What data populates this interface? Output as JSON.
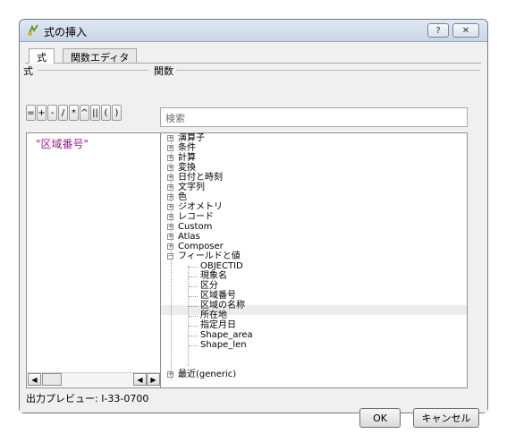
{
  "window": {
    "title": "式の挿入",
    "help_label": "?",
    "close_label": "✕"
  },
  "tabs": [
    {
      "label": "式",
      "active": true
    },
    {
      "label": "関数エディタ",
      "active": false
    }
  ],
  "expression_group": {
    "label": "式",
    "operators": [
      "=",
      "+",
      "-",
      "/",
      "*",
      "^",
      "||",
      "(",
      ")"
    ],
    "expression_text": "\"区域番号\"",
    "preview_label": "出力プレビュー:",
    "preview_value": "I-33-0700"
  },
  "functions_group": {
    "label": "関数",
    "search_placeholder": "検索",
    "tree": [
      {
        "label": "演算子",
        "expandable": true
      },
      {
        "label": "条件",
        "expandable": true
      },
      {
        "label": "計算",
        "expandable": true
      },
      {
        "label": "変換",
        "expandable": true
      },
      {
        "label": "日付と時刻",
        "expandable": true
      },
      {
        "label": "文字列",
        "expandable": true
      },
      {
        "label": "色",
        "expandable": true
      },
      {
        "label": "ジオメトリ",
        "expandable": true
      },
      {
        "label": "レコード",
        "expandable": true
      },
      {
        "label": "Custom",
        "expandable": true
      },
      {
        "label": "Atlas",
        "expandable": true
      },
      {
        "label": "Composer",
        "expandable": true
      },
      {
        "label": "フィールドと値",
        "expandable": true,
        "expanded": true
      },
      {
        "label": "OBJECTID",
        "child": true
      },
      {
        "label": "現象名",
        "child": true
      },
      {
        "label": "区分",
        "child": true
      },
      {
        "label": "区域番号",
        "child": true,
        "selected": true
      },
      {
        "label": "区域の名称",
        "child": true
      },
      {
        "label": "所在地",
        "child": true
      },
      {
        "label": "指定月日",
        "child": true
      },
      {
        "label": "Shape_area",
        "child": true
      },
      {
        "label": "Shape_len",
        "child": true
      },
      {
        "label": "最近(generic)",
        "expandable": true
      }
    ]
  },
  "buttons": {
    "ok": "OK",
    "cancel": "キャンセル"
  }
}
